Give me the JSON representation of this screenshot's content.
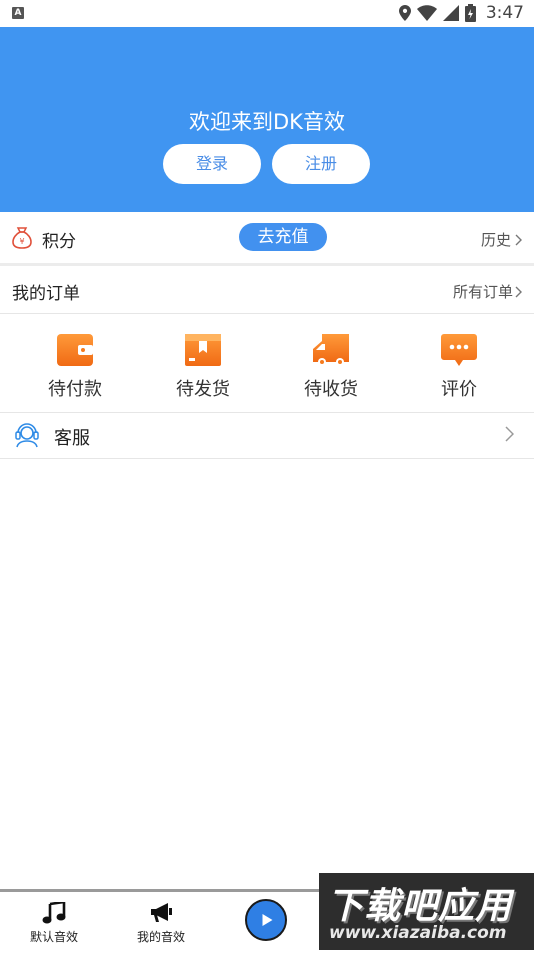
{
  "status_bar": {
    "app_badge": "A",
    "time": "3:47"
  },
  "header": {
    "welcome": "欢迎来到DK音效",
    "login_label": "登录",
    "register_label": "注册",
    "background_color": "#4095f1"
  },
  "points": {
    "label": "积分",
    "recharge_label": "去充值",
    "history_label": "历史",
    "icon": "money-bag-icon"
  },
  "orders": {
    "title": "我的订单",
    "all_orders_label": "所有订单",
    "statuses": [
      {
        "label": "待付款",
        "icon": "wallet-icon"
      },
      {
        "label": "待发货",
        "icon": "box-icon"
      },
      {
        "label": "待收货",
        "icon": "truck-icon"
      },
      {
        "label": "评价",
        "icon": "chat-bubble-icon"
      }
    ],
    "icon_color": "#f57b1e"
  },
  "service": {
    "label": "客服",
    "icon": "headset-icon"
  },
  "bottom_nav": {
    "tabs": [
      {
        "label": "默认音效",
        "icon": "music-note-icon"
      },
      {
        "label": "我的音效",
        "icon": "megaphone-icon"
      }
    ],
    "play_icon": "play-icon",
    "accent": "#2f7fe4"
  },
  "watermark": {
    "title": "下载吧应用",
    "url": "www.xiazaiba.com"
  }
}
